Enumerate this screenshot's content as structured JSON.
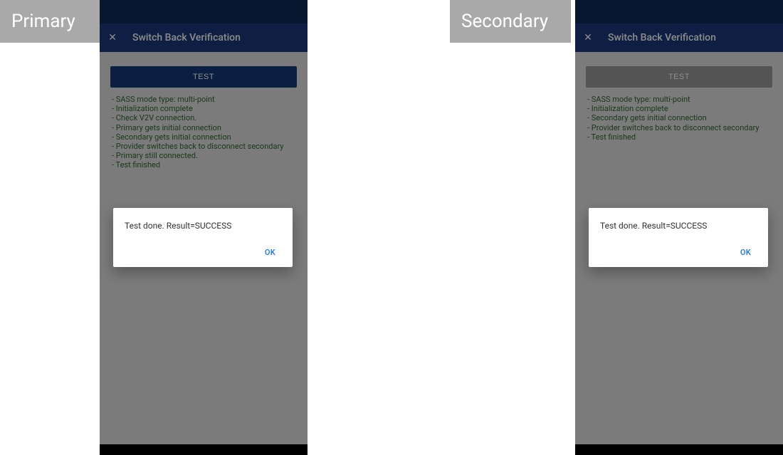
{
  "tags": {
    "primary": "Primary",
    "secondary": "Secondary"
  },
  "primary": {
    "appbar": {
      "close_glyph": "✕",
      "title": "Switch Back Verification"
    },
    "test_button": "TEST",
    "log_lines": [
      "- SASS mode type: multi-point",
      "- Initialization complete",
      "- Check V2V connection.",
      "- Primary gets initial connection",
      "- Secondary gets initial connection",
      "- Provider switches back to disconnect secondary",
      "- Primary still connected.",
      "- Test finished"
    ],
    "dialog": {
      "message": "Test done. Result=SUCCESS",
      "ok": "OK"
    }
  },
  "secondary": {
    "appbar": {
      "close_glyph": "✕",
      "title": "Switch Back Verification"
    },
    "test_button": "TEST",
    "log_lines": [
      "- SASS mode type: multi-point",
      "- Initialization complete",
      "- Secondary gets initial connection",
      "- Provider switches back to disconnect secondary",
      "- Test finished"
    ],
    "dialog": {
      "message": "Test done. Result=SUCCESS",
      "ok": "OK"
    }
  }
}
